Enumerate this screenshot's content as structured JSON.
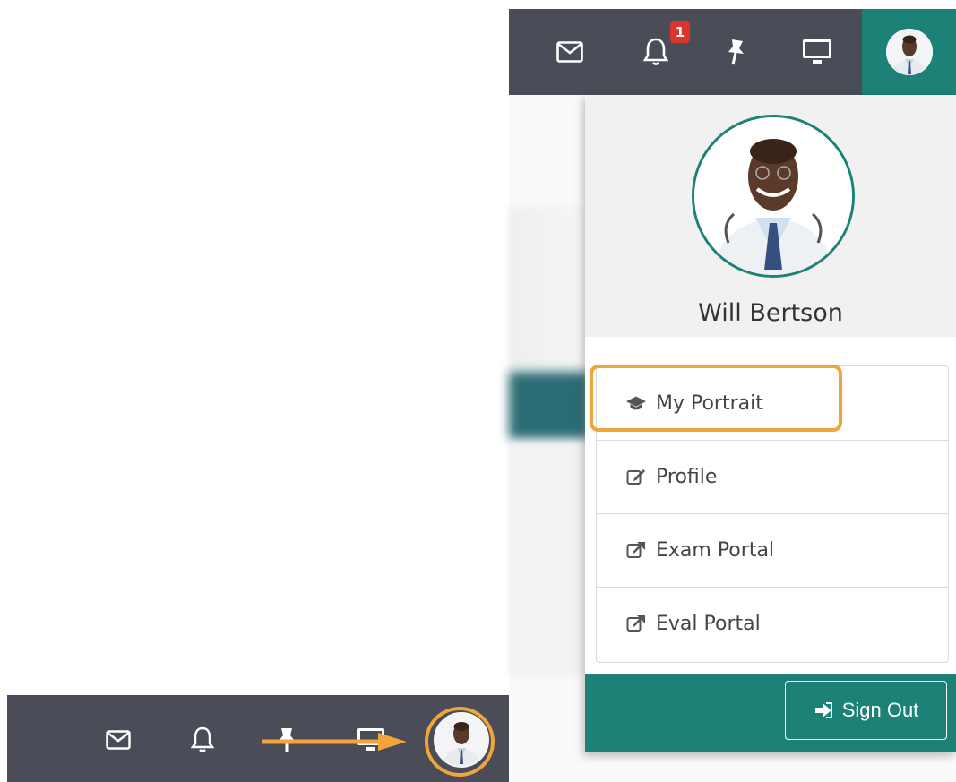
{
  "navbar": {
    "notification_count": "1",
    "icons": [
      "mail-icon",
      "bell-icon",
      "pin-icon",
      "monitor-icon"
    ]
  },
  "user": {
    "name": "Will Bertson"
  },
  "menu": {
    "items": [
      {
        "label": "My Portrait",
        "icon": "graduation-cap-icon"
      },
      {
        "label": "Profile",
        "icon": "edit-icon"
      },
      {
        "label": "Exam Portal",
        "icon": "external-link-icon"
      },
      {
        "label": "Eval Portal",
        "icon": "external-link-icon"
      }
    ]
  },
  "footer": {
    "sign_out_label": "Sign Out"
  },
  "colors": {
    "navbar_bg": "#4a4c57",
    "accent_teal": "#1c8177",
    "highlight_orange": "#f0a43a",
    "badge_red": "#d9352c"
  }
}
